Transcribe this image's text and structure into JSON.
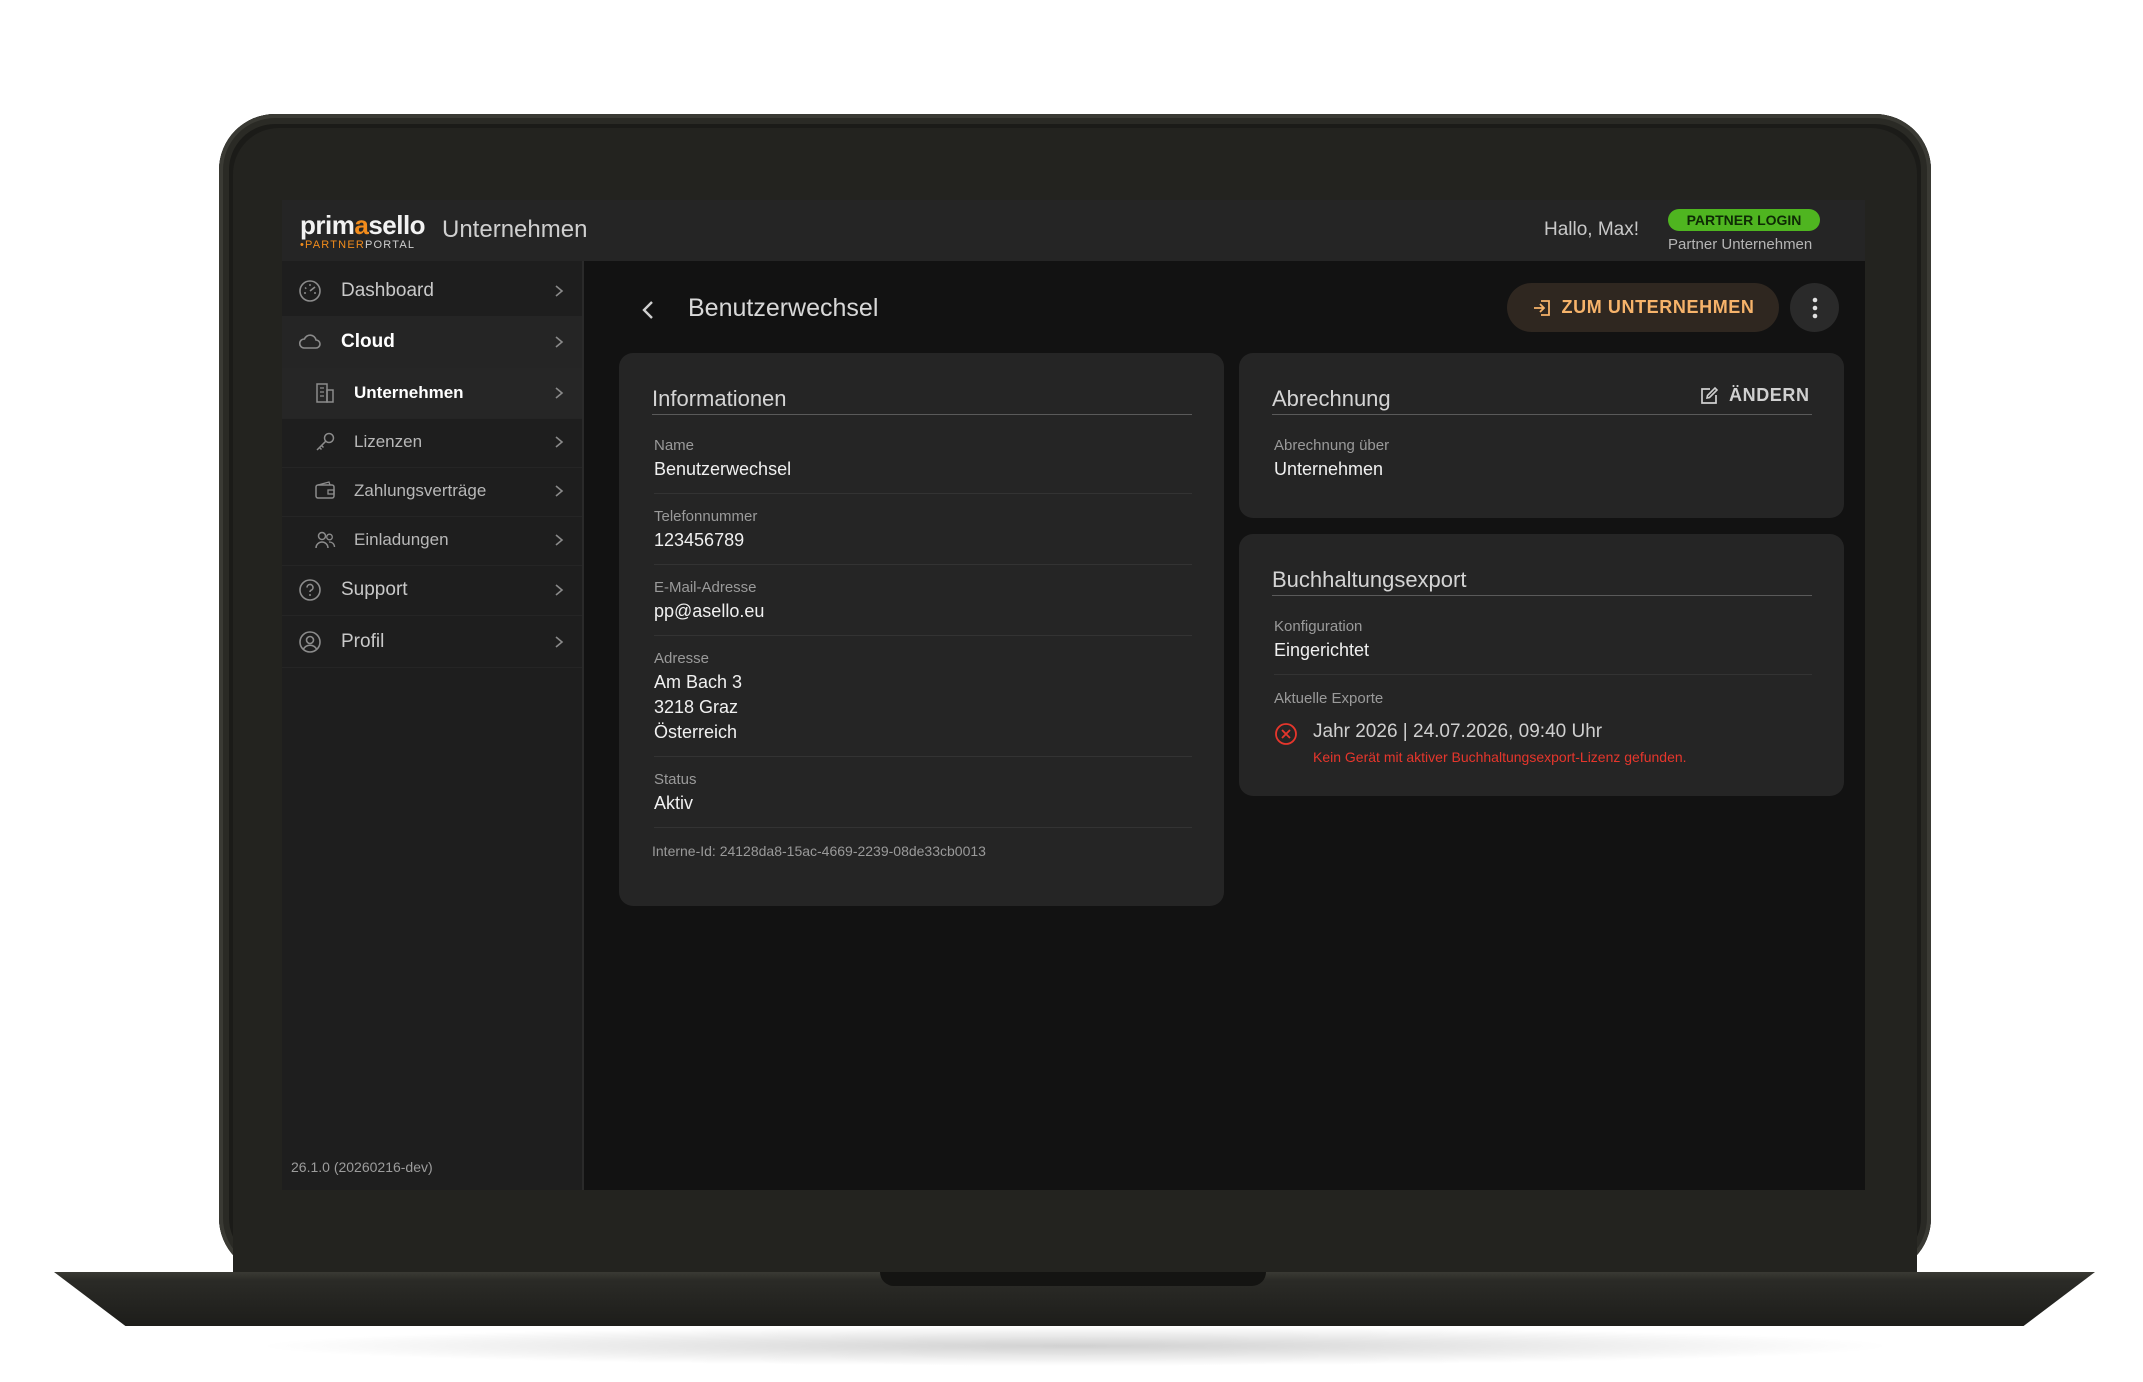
{
  "header": {
    "logo_text_left": "prim",
    "logo_text_accent": "a",
    "logo_text_right": "sello",
    "logo_sub_accent": "•PARTNER",
    "logo_sub_rest": "PORTAL",
    "app_title": "Unternehmen",
    "greeting": "Hallo, Max!",
    "partner_badge": "PARTNER LOGIN",
    "partner_sub": "Partner Unternehmen"
  },
  "sidebar": {
    "items": [
      {
        "label": "Dashboard",
        "icon": "gauge-icon"
      },
      {
        "label": "Cloud",
        "icon": "cloud-icon"
      },
      {
        "label": "Unternehmen",
        "icon": "building-icon"
      },
      {
        "label": "Lizenzen",
        "icon": "key-icon"
      },
      {
        "label": "Zahlungsverträge",
        "icon": "wallet-icon"
      },
      {
        "label": "Einladungen",
        "icon": "users-icon"
      },
      {
        "label": "Support",
        "icon": "help-icon"
      },
      {
        "label": "Profil",
        "icon": "user-circle-icon"
      }
    ],
    "version": "26.1.0 (20260216-dev)"
  },
  "main": {
    "title": "Benutzerwechsel",
    "company_button": "ZUM UNTERNEHMEN",
    "info_card": {
      "title": "Informationen",
      "name_label": "Name",
      "name_value": "Benutzerwechsel",
      "phone_label": "Telefonnummer",
      "phone_value": "123456789",
      "email_label": "E-Mail-Adresse",
      "email_value": "pp@asello.eu",
      "address_label": "Adresse",
      "address_line1": "Am Bach 3",
      "address_line2": "3218 Graz",
      "address_line3": "Österreich",
      "status_label": "Status",
      "status_value": "Aktiv",
      "intern_id": "Interne-Id: 24128da8-15ac-4669-2239-08de33cb0013"
    },
    "billing_card": {
      "title": "Abrechnung",
      "edit_label": "ÄNDERN",
      "billing_label": "Abrechnung über",
      "billing_value": "Unternehmen"
    },
    "export_card": {
      "title": "Buchhaltungsexport",
      "config_label": "Konfiguration",
      "config_value": "Eingerichtet",
      "exports_label": "Aktuelle Exporte",
      "export_entry": "Jahr 2026 | 24.07.2026, 09:40 Uhr",
      "export_error": "Kein Gerät mit aktiver Buchhaltungsexport-Lizenz gefunden."
    }
  },
  "colors": {
    "accent_orange": "#f28c1c",
    "badge_green": "#4fb520",
    "error_red": "#e6362c",
    "button_text": "#f6b36a"
  }
}
